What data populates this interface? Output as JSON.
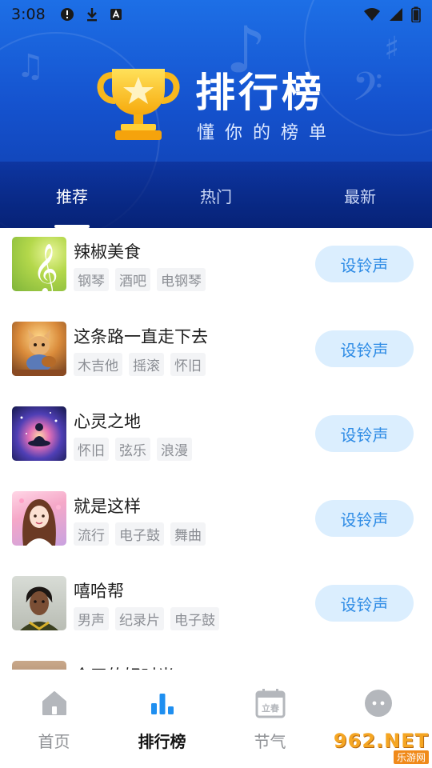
{
  "status_bar": {
    "time": "3:08"
  },
  "banner": {
    "title": "排行榜",
    "subtitle": "懂你的榜单"
  },
  "tabs": [
    {
      "label": "推荐",
      "active": true
    },
    {
      "label": "热门",
      "active": false
    },
    {
      "label": "最新",
      "active": false
    }
  ],
  "songs": [
    {
      "title": "辣椒美食",
      "tags": [
        "钢琴",
        "酒吧",
        "电钢琴"
      ],
      "button": "设铃声"
    },
    {
      "title": "这条路一直走下去",
      "tags": [
        "木吉他",
        "摇滚",
        "怀旧"
      ],
      "button": "设铃声"
    },
    {
      "title": "心灵之地",
      "tags": [
        "怀旧",
        "弦乐",
        "浪漫"
      ],
      "button": "设铃声"
    },
    {
      "title": "就是这样",
      "tags": [
        "流行",
        "电子鼓",
        "舞曲"
      ],
      "button": "设铃声"
    },
    {
      "title": "嘻哈帮",
      "tags": [
        "男声",
        "纪录片",
        "电子鼓"
      ],
      "button": "设铃声"
    },
    {
      "title": "今天的好时光",
      "tags": [],
      "button": ""
    }
  ],
  "bottom_nav": [
    {
      "label": "首页",
      "icon": "home-icon",
      "active": false
    },
    {
      "label": "排行榜",
      "icon": "ranking-icon",
      "active": true
    },
    {
      "label": "节气",
      "icon": "calendar-icon",
      "active": false,
      "icon_text": "立春"
    },
    {
      "label": "",
      "icon": "face-icon",
      "active": false
    }
  ],
  "watermark": {
    "main": "962.NET",
    "sub": "乐游网"
  },
  "colors": {
    "banner_top": "#1d6fe6",
    "banner_bottom": "#0e3aa8",
    "button_bg": "#dbeefe",
    "button_text": "#2f8ce5",
    "tag_bg": "#f3f4f6",
    "nav_active": "#1f8ff0",
    "nav_inactive": "#b4b7bc"
  }
}
